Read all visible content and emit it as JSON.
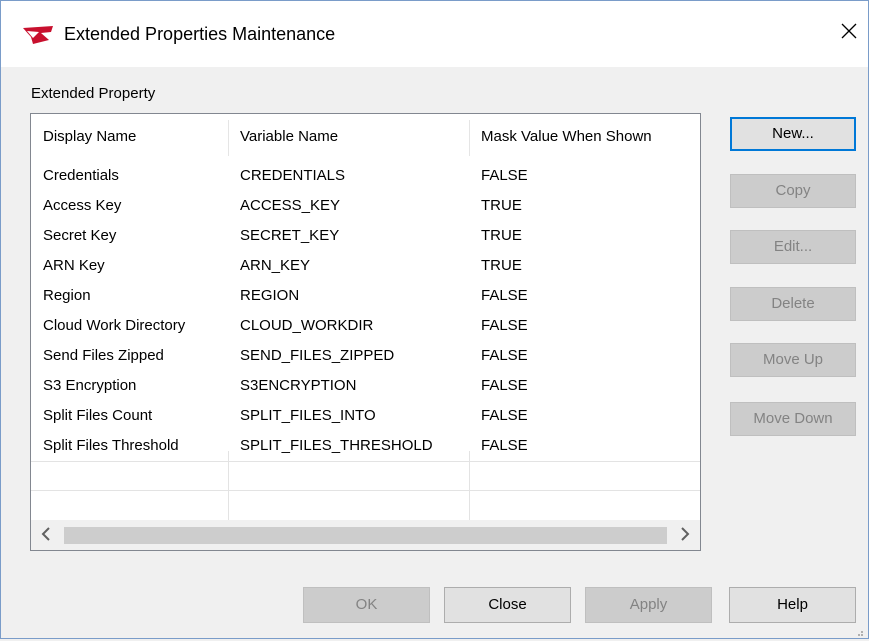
{
  "window": {
    "title": "Extended Properties Maintenance"
  },
  "group_label": "Extended Property",
  "table": {
    "columns": [
      "Display Name",
      "Variable Name",
      "Mask Value When Shown"
    ],
    "rows": [
      [
        "Credentials",
        "CREDENTIALS",
        "FALSE"
      ],
      [
        "Access Key",
        "ACCESS_KEY",
        "TRUE"
      ],
      [
        "Secret Key",
        "SECRET_KEY",
        "TRUE"
      ],
      [
        "ARN Key",
        "ARN_KEY",
        "TRUE"
      ],
      [
        "Region",
        "REGION",
        "FALSE"
      ],
      [
        "Cloud Work Directory",
        "CLOUD_WORKDIR",
        "FALSE"
      ],
      [
        "Send Files Zipped",
        "SEND_FILES_ZIPPED",
        "FALSE"
      ],
      [
        "S3 Encryption",
        "S3ENCRYPTION",
        "FALSE"
      ],
      [
        "Split Files Count",
        "SPLIT_FILES_INTO",
        "FALSE"
      ],
      [
        "Split Files Threshold",
        "SPLIT_FILES_THRESHOLD",
        "FALSE"
      ]
    ]
  },
  "side_buttons": {
    "new": "New...",
    "copy": "Copy",
    "edit": "Edit...",
    "delete": "Delete",
    "move_up": "Move Up",
    "move_down": "Move Down"
  },
  "bottom_buttons": {
    "ok": "OK",
    "close": "Close",
    "apply": "Apply",
    "help": "Help"
  },
  "colors": {
    "accent": "#0078d7",
    "logo": "#c8102e",
    "disabled_text": "#838383"
  },
  "icons": {
    "app": "app-logo-icon",
    "close": "close-icon",
    "scroll_left": "chevron-left-icon",
    "scroll_right": "chevron-right-icon"
  }
}
